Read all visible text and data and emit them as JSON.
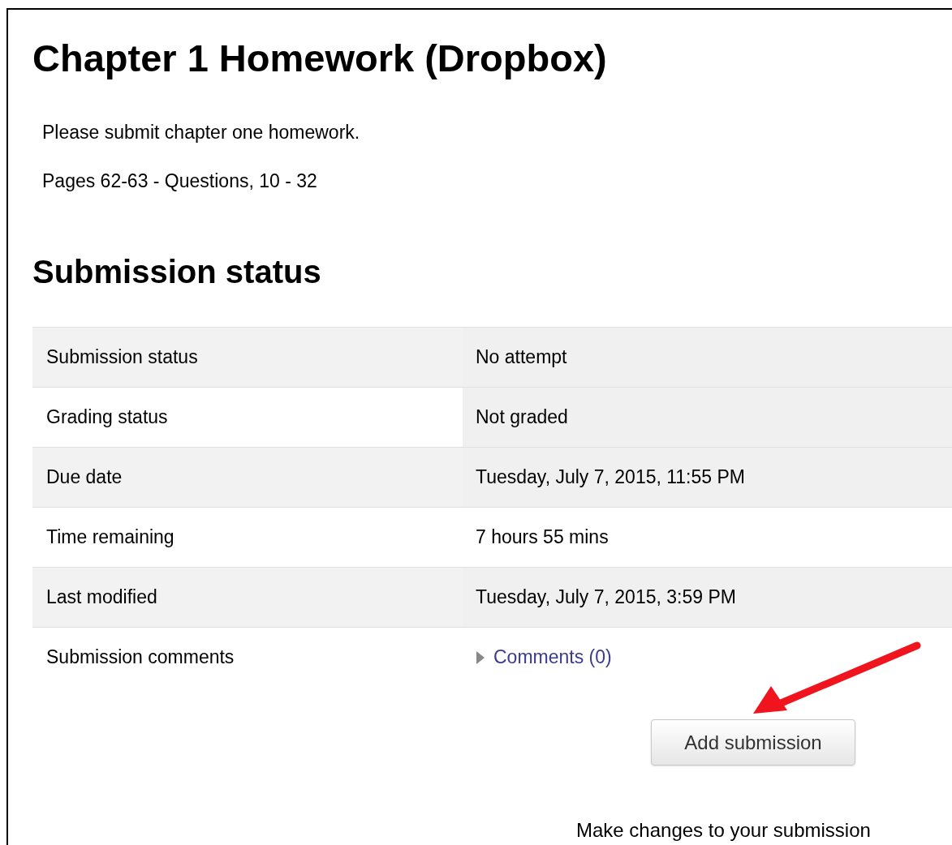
{
  "title": "Chapter 1 Homework (Dropbox)",
  "description": [
    "Please submit chapter one homework.",
    "Pages 62-63 - Questions, 10 - 32"
  ],
  "section_heading": "Submission status",
  "rows": [
    {
      "label": "Submission status",
      "label_shaded": true,
      "value": "No attempt",
      "value_shaded": true,
      "kind": "text"
    },
    {
      "label": "Grading status",
      "label_shaded": false,
      "value": "Not graded",
      "value_shaded": true,
      "kind": "text"
    },
    {
      "label": "Due date",
      "label_shaded": true,
      "value": "Tuesday, July 7, 2015, 11:55 PM",
      "value_shaded": true,
      "kind": "text"
    },
    {
      "label": "Time remaining",
      "label_shaded": false,
      "value": "7 hours 55 mins",
      "value_shaded": false,
      "kind": "text"
    },
    {
      "label": "Last modified",
      "label_shaded": true,
      "value": "Tuesday, July 7, 2015, 3:59 PM",
      "value_shaded": true,
      "kind": "text"
    },
    {
      "label": "Submission comments",
      "label_shaded": false,
      "value": "Comments (0)",
      "value_shaded": false,
      "kind": "link",
      "expanded": false
    }
  ],
  "button": "Add submission",
  "note": "Make changes to your submission"
}
